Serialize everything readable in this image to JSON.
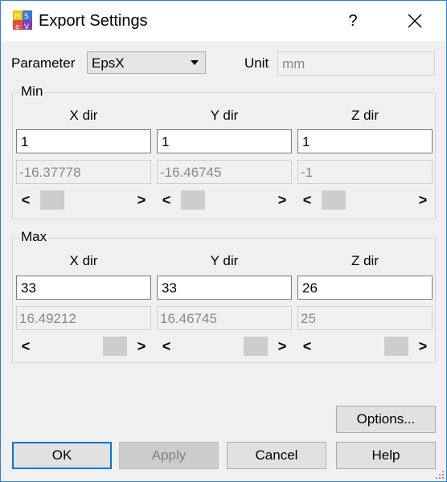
{
  "window": {
    "title": "Export Settings",
    "help_glyph": "?",
    "close_glyph": "✕",
    "icon": "app-logo-icon"
  },
  "parameter": {
    "label": "Parameter",
    "value": "EpsX"
  },
  "unit": {
    "label": "Unit",
    "value": "mm"
  },
  "min": {
    "title": "Min",
    "columns": [
      {
        "header": "X dir",
        "input": "1",
        "readonly": "-16.37778"
      },
      {
        "header": "Y dir",
        "input": "1",
        "readonly": "-16.46745"
      },
      {
        "header": "Z dir",
        "input": "1",
        "readonly": "-1"
      }
    ]
  },
  "max": {
    "title": "Max",
    "columns": [
      {
        "header": "X dir",
        "input": "33",
        "readonly": "16.49212"
      },
      {
        "header": "Y dir",
        "input": "33",
        "readonly": "16.46745"
      },
      {
        "header": "Z dir",
        "input": "26",
        "readonly": "25"
      }
    ]
  },
  "scroll_glyphs": {
    "left": "<",
    "right": ">"
  },
  "buttons": {
    "options": "Options...",
    "ok": "OK",
    "apply": "Apply",
    "cancel": "Cancel",
    "help": "Help"
  }
}
